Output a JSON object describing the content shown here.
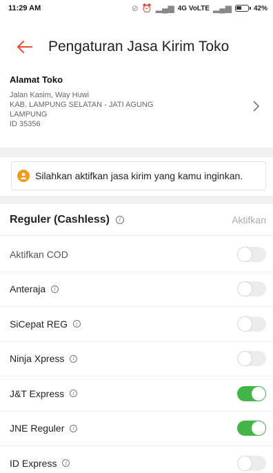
{
  "status_bar": {
    "time": "11:29 AM",
    "network": "4G VoLTE",
    "battery": "42%"
  },
  "header": {
    "title": "Pengaturan Jasa Kirim Toko",
    "back_icon": "arrow-left-icon"
  },
  "address": {
    "title": "Alamat Toko",
    "line1": "Jalan Kasim, Way Huwi",
    "line2": "KAB. LAMPUNG SELATAN - JATI AGUNG",
    "line3": "LAMPUNG",
    "line4": "ID 35356"
  },
  "notice": {
    "text": "Silahkan aktifkan jasa kirim yang kamu inginkan.",
    "icon": "warning-icon"
  },
  "section": {
    "title": "Reguler (Cashless)",
    "action": "Aktifkan"
  },
  "couriers": [
    {
      "label": "Aktifkan COD",
      "enabled": false
    },
    {
      "label": "Anteraja",
      "enabled": false
    },
    {
      "label": "SiCepat REG",
      "enabled": false
    },
    {
      "label": "Ninja Xpress",
      "enabled": false
    },
    {
      "label": "J&T Express",
      "enabled": true
    },
    {
      "label": "JNE Reguler",
      "enabled": true
    },
    {
      "label": "ID Express",
      "enabled": false
    }
  ],
  "colors": {
    "accent": "#ee4d2d",
    "toggle_on": "#42b549",
    "notice_icon": "#f29b1e"
  }
}
